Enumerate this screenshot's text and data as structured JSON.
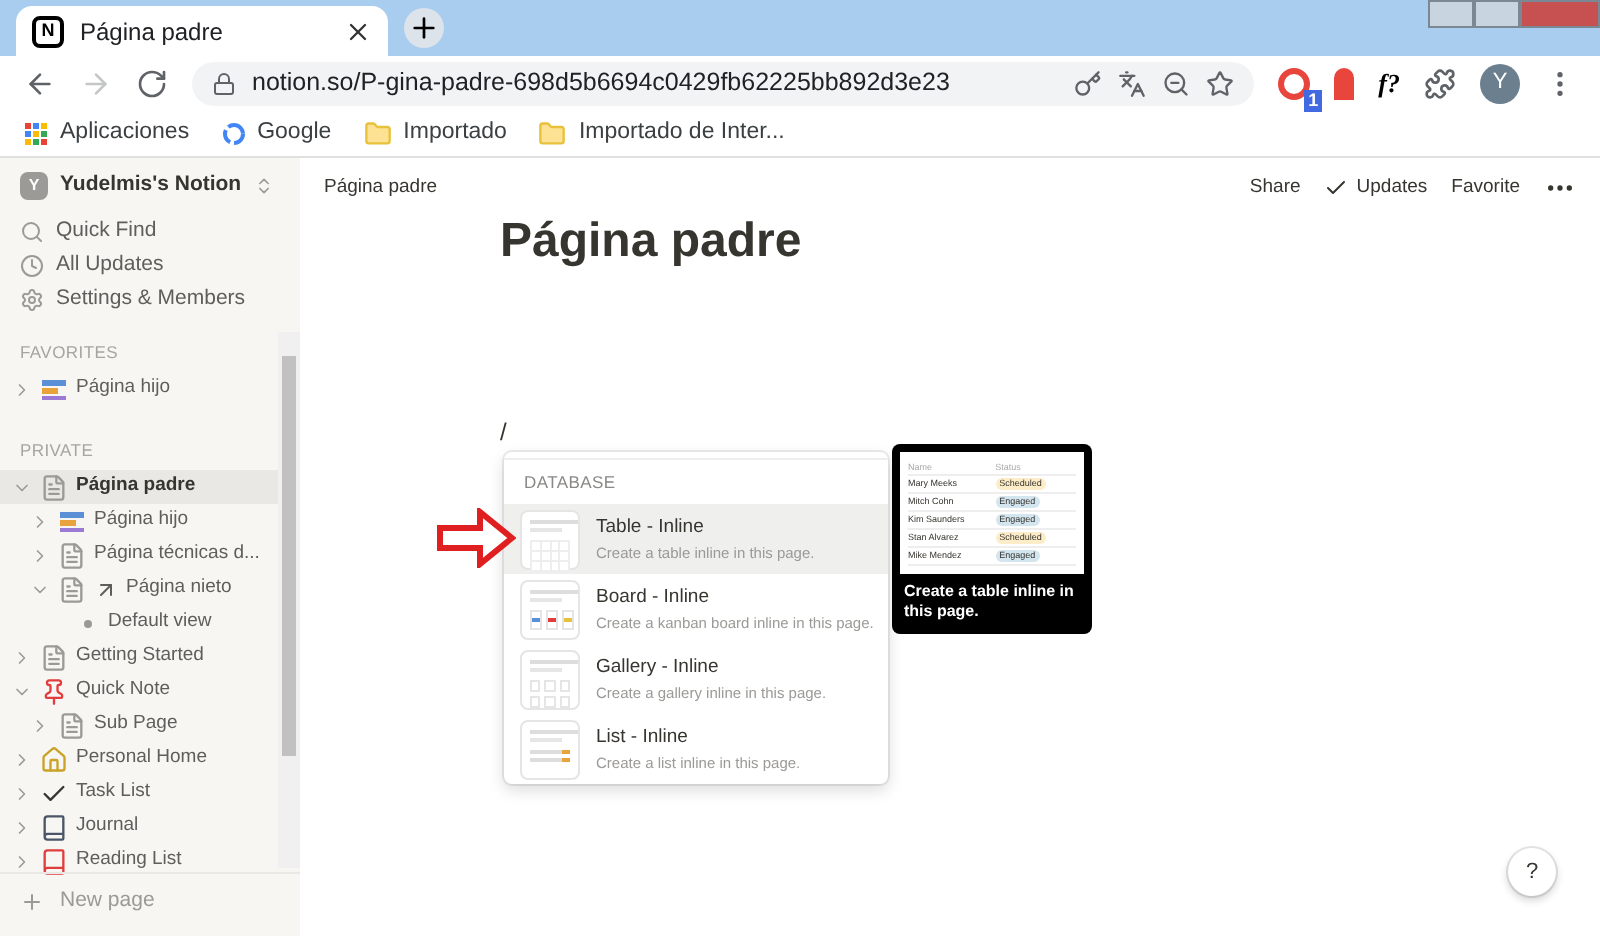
{
  "browser": {
    "tab": {
      "logo_letter": "N",
      "title": "Página padre"
    },
    "extension_label": "f?",
    "address": "notion.so/P-gina-padre-698d5b6694c0429fb62225bb892d3e23",
    "extension_badge": "1",
    "avatar": "Y",
    "bookmarks": [
      {
        "kind": "apps",
        "label": "Aplicaciones"
      },
      {
        "kind": "google",
        "label": "Google"
      },
      {
        "kind": "folder",
        "label": "Importado"
      },
      {
        "kind": "folder",
        "label": "Importado de Inter..."
      }
    ]
  },
  "sidebar": {
    "workspace": {
      "initial": "Y",
      "name": "Yudelmis's Notion"
    },
    "actions": [
      {
        "kind": "search",
        "label": "Quick Find"
      },
      {
        "kind": "clock",
        "label": "All Updates"
      },
      {
        "kind": "gear",
        "label": "Settings & Members"
      }
    ],
    "sections": [
      {
        "title": "FAVORITES",
        "items": [
          {
            "kind": "database",
            "label": "Página hijo",
            "expanded": false,
            "selected": false
          }
        ]
      },
      {
        "title": "PRIVATE",
        "items": [
          {
            "kind": "page",
            "label": "Página padre",
            "expanded": true,
            "selected": true,
            "children": [
              {
                "kind": "database",
                "label": "Página hijo",
                "expanded": false,
                "selected": false
              },
              {
                "kind": "page",
                "label": "Página técnicas d...",
                "expanded": false,
                "selected": false
              },
              {
                "kind": "link",
                "label": "Página nieto",
                "expanded": true,
                "selected": false,
                "children": [
                  {
                    "kind": "view",
                    "label": "Default view",
                    "selected": false
                  }
                ]
              }
            ]
          },
          {
            "kind": "page",
            "label": "Getting Started",
            "expanded": false,
            "selected": false
          },
          {
            "kind": "pin",
            "label": "Quick Note",
            "expanded": true,
            "selected": false,
            "children": [
              {
                "kind": "page",
                "label": "Sub Page",
                "expanded": false,
                "selected": false
              }
            ]
          },
          {
            "kind": "house",
            "label": "Personal Home",
            "expanded": false,
            "selected": false
          },
          {
            "kind": "check",
            "label": "Task List",
            "expanded": false,
            "selected": false
          },
          {
            "kind": "book",
            "label": "Journal",
            "expanded": false,
            "selected": false
          },
          {
            "kind": "redbook",
            "label": "Reading List",
            "expanded": false,
            "selected": false
          }
        ]
      }
    ],
    "new_page": "New page"
  },
  "topbar": {
    "breadcrumb": "Página padre",
    "actions": [
      "Share",
      "Updates",
      "Favorite"
    ]
  },
  "page": {
    "title": "Página padre",
    "typed": "/"
  },
  "menu": {
    "section": "DATABASE",
    "items": [
      {
        "kind": "table",
        "title": "Table - Inline",
        "description": "Create a table inline in this page.",
        "selected": true
      },
      {
        "kind": "board",
        "title": "Board - Inline",
        "description": "Create a kanban board inline in this page.",
        "selected": false
      },
      {
        "kind": "gallery",
        "title": "Gallery - Inline",
        "description": "Create a gallery inline in this page.",
        "selected": false
      },
      {
        "kind": "list",
        "title": "List - Inline",
        "description": "Create a list inline in this page.",
        "selected": false
      }
    ]
  },
  "preview": {
    "columns": [
      "Name",
      "Status"
    ],
    "rows": [
      {
        "name": "Mary Meeks",
        "status": "Scheduled",
        "color": "#fdecc8"
      },
      {
        "name": "Mitch Cohn",
        "status": "Engaged",
        "color": "#d3e5ef"
      },
      {
        "name": "Kim Saunders",
        "status": "Engaged",
        "color": "#d3e5ef"
      },
      {
        "name": "Stan Alvarez",
        "status": "Scheduled",
        "color": "#fdecc8"
      },
      {
        "name": "Mike Mendez",
        "status": "Engaged",
        "color": "#d3e5ef"
      }
    ],
    "caption": "Create a table inline in this page."
  },
  "help": "?"
}
